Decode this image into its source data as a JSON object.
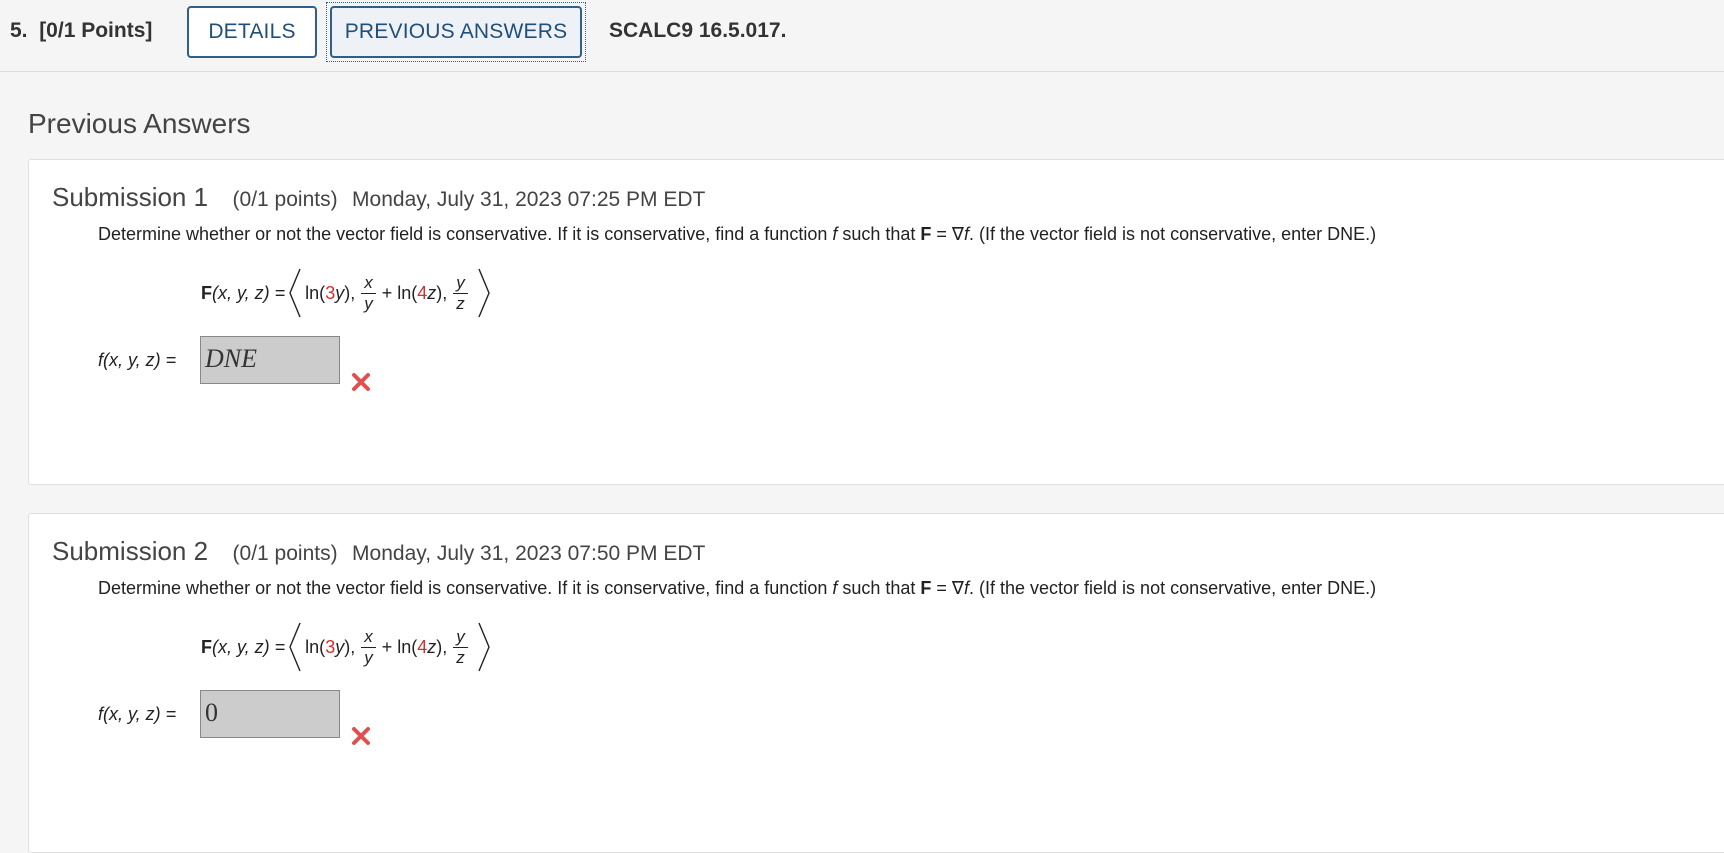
{
  "header": {
    "question_number": "5.",
    "points": "[0/1 Points]",
    "details_label": "DETAILS",
    "previous_answers_label": "PREVIOUS ANSWERS",
    "code": "SCALC9 16.5.017."
  },
  "section_title": "Previous Answers",
  "submissions": [
    {
      "title": "Submission 1",
      "points": "(0/1 points)",
      "date": "Monday, July 31, 2023 07:25 PM EDT",
      "answer": "DNE",
      "answer_status": "incorrect"
    },
    {
      "title": "Submission 2",
      "points": "(0/1 points)",
      "date": "Monday, July 31, 2023 07:50 PM EDT",
      "answer": "0",
      "answer_status": "incorrect"
    }
  ],
  "question": {
    "part1": "Determine whether or not the vector field is conservative. If it is conservative, find a function ",
    "f": "f",
    "part2": " such that ",
    "F": "F",
    "part3": " = ∇",
    "part4": ". (If the vector field is not conservative, enter DNE.)"
  },
  "formula": {
    "lhs_F": "F",
    "lhs_args": "(x, y, z) =",
    "ln": "ln(",
    "coef1": "3",
    "var1": "y",
    "close1": "),",
    "frac1_num": "x",
    "frac1_den": "y",
    "plus_ln": "+ ln(",
    "coef2": "4",
    "var2": "z",
    "close2": "),",
    "frac2_num": "y",
    "frac2_den": "z"
  },
  "answer_label": "f(x, y, z) =",
  "colors": {
    "accent": "#2f5f8a",
    "error": "#e05050",
    "coefficient": "#d32f2f"
  }
}
